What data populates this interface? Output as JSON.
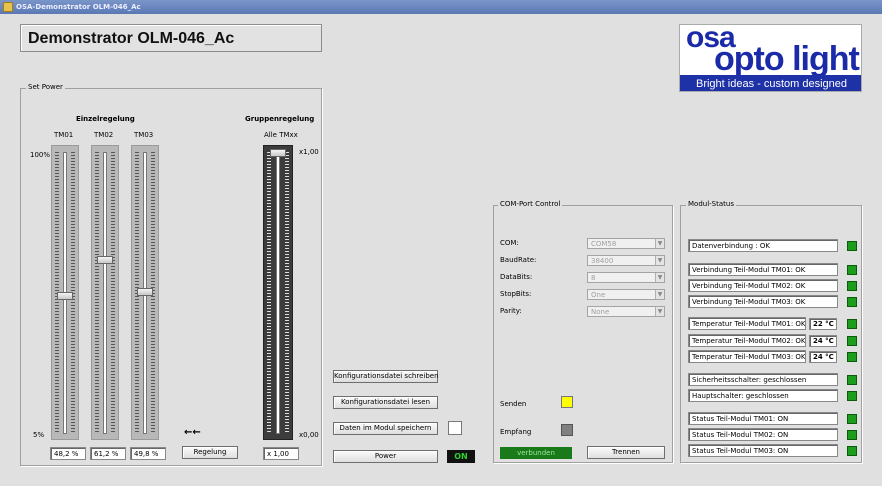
{
  "window": {
    "title": "OSA-Demonstrator OLM-046_Ac"
  },
  "header": {
    "title": "Demonstrator OLM-046_Ac"
  },
  "logo": {
    "line1": "osa",
    "line2": "opto light",
    "tagline": "Bright ideas - custom designed",
    "brand_color": "#1e31a6"
  },
  "set_power": {
    "legend": "Set Power",
    "einzel_heading": "Einzelregelung",
    "gruppen_heading": "Gruppenregelung",
    "scale_top": "100%",
    "scale_bottom": "5%",
    "channels": [
      {
        "label": "TM01",
        "value": "48,2  %",
        "level": 0.482
      },
      {
        "label": "TM02",
        "value": "61,2  %",
        "level": 0.612
      },
      {
        "label": "TM03",
        "value": "49,8  %",
        "level": 0.498
      }
    ],
    "group": {
      "label": "Alle TMxx",
      "top_label": "x1,00",
      "bottom_label": "x0,00",
      "value": "x 1,00",
      "level": 1.0
    },
    "arrows": "←←",
    "regelung_button": "Regelung"
  },
  "actions": {
    "write_config": "Konfigurationsdatei schreiben",
    "read_config": "Konfigurationsdatei lesen",
    "save_module": "Daten im Modul speichern",
    "power": "Power",
    "power_state": "ON"
  },
  "com_port": {
    "legend": "COM-Port Control",
    "fields": [
      {
        "label": "COM:",
        "value": "COM58"
      },
      {
        "label": "BaudRate:",
        "value": "38400"
      },
      {
        "label": "DataBits:",
        "value": "8"
      },
      {
        "label": "StopBits:",
        "value": "One"
      },
      {
        "label": "Parity:",
        "value": "None"
      }
    ],
    "send_label": "Senden",
    "receive_label": "Empfang",
    "connected_label": "verbunden",
    "disconnect_button": "Trennen",
    "send_color": "#ffff00",
    "receive_color": "#808080",
    "connected_color": "#1a7a1a"
  },
  "modul_status": {
    "legend": "Modul-Status",
    "rows": [
      {
        "text": "Datenverbindung : OK"
      },
      {
        "text": "Verbindung Teil-Modul TM01: OK"
      },
      {
        "text": "Verbindung Teil-Modul TM02: OK"
      },
      {
        "text": "Verbindung Teil-Modul TM03: OK"
      },
      {
        "text": "Temperatur Teil-Modul TM01: OK",
        "temp": "22 °C"
      },
      {
        "text": "Temperatur Teil-Modul TM02: OK",
        "temp": "24 °C"
      },
      {
        "text": "Temperatur Teil-Modul TM03: OK",
        "temp": "24 °C"
      },
      {
        "text": "Sicherheitsschalter: geschlossen"
      },
      {
        "text": "Hauptschalter: geschlossen"
      },
      {
        "text": "Status Teil-Modul TM01:  ON"
      },
      {
        "text": "Status Teil-Modul TM02:  ON"
      },
      {
        "text": "Status Teil-Modul TM03:  ON"
      }
    ],
    "led_color": "#1c9e1c"
  }
}
